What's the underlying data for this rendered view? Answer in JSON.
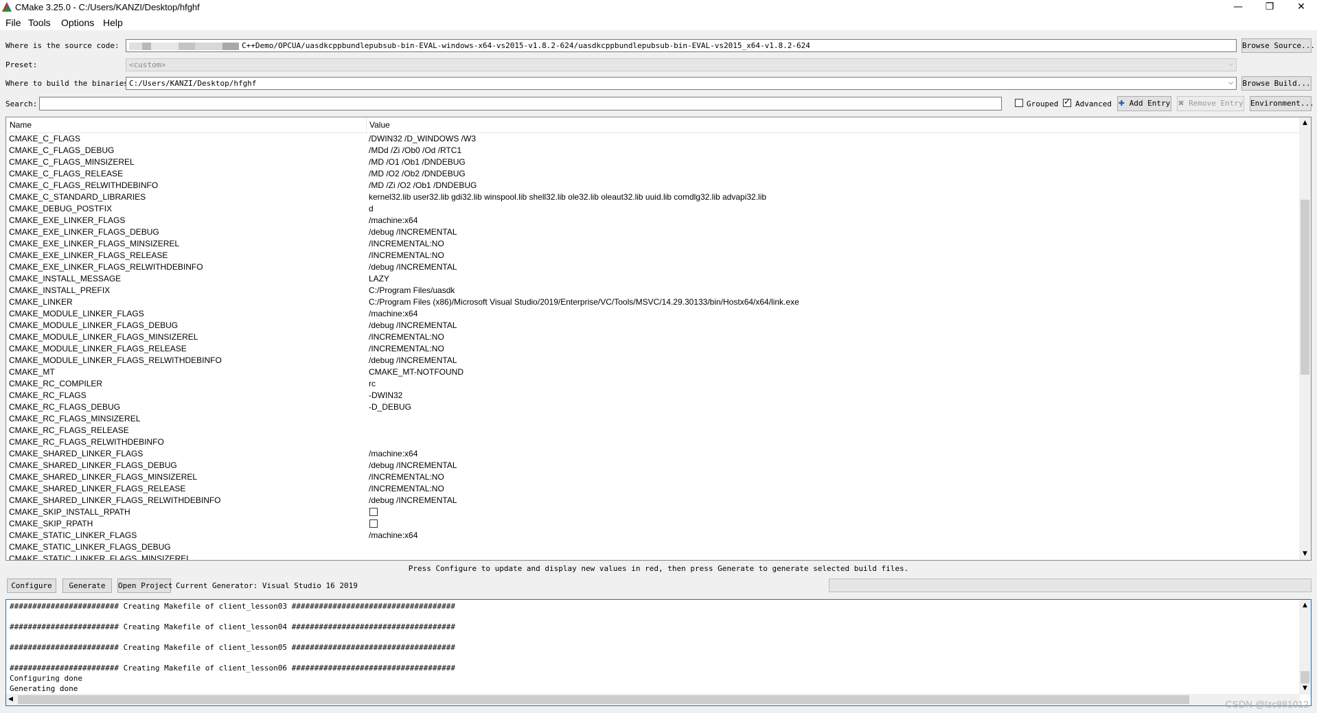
{
  "window": {
    "title": "CMake 3.25.0 - C:/Users/KANZI/Desktop/hfghf",
    "minimize": "—",
    "restore": "❐",
    "close": "✕"
  },
  "menu": [
    "File",
    "Tools",
    "Options",
    "Help"
  ],
  "source": {
    "label": "Where is the source code:",
    "value": "C++Demo/OPCUA/uasdkcppbundlepubsub-bin-EVAL-windows-x64-vs2015-v1.8.2-624/uasdkcppbundlepubsub-bin-EVAL-vs2015_x64-v1.8.2-624",
    "browse": "Browse Source..."
  },
  "preset": {
    "label": "Preset:",
    "value": "<custom>"
  },
  "build": {
    "label": "Where to build the binaries:",
    "value": "C:/Users/KANZI/Desktop/hfghf",
    "browse": "Browse Build..."
  },
  "search": {
    "label": "Search:",
    "value": "",
    "grouped": "Grouped",
    "grouped_checked": false,
    "advanced": "Advanced",
    "advanced_checked": true,
    "add_entry": "Add Entry",
    "remove_entry": "Remove Entry",
    "environment": "Environment..."
  },
  "table": {
    "col_name": "Name",
    "col_value": "Value",
    "rows": [
      {
        "name": "CMAKE_C_FLAGS",
        "value": "/DWIN32 /D_WINDOWS /W3"
      },
      {
        "name": "CMAKE_C_FLAGS_DEBUG",
        "value": "/MDd /Zi /Ob0 /Od /RTC1"
      },
      {
        "name": "CMAKE_C_FLAGS_MINSIZEREL",
        "value": "/MD /O1 /Ob1 /DNDEBUG"
      },
      {
        "name": "CMAKE_C_FLAGS_RELEASE",
        "value": "/MD /O2 /Ob2 /DNDEBUG"
      },
      {
        "name": "CMAKE_C_FLAGS_RELWITHDEBINFO",
        "value": "/MD /Zi /O2 /Ob1 /DNDEBUG"
      },
      {
        "name": "CMAKE_C_STANDARD_LIBRARIES",
        "value": "kernel32.lib user32.lib gdi32.lib winspool.lib shell32.lib ole32.lib oleaut32.lib uuid.lib comdlg32.lib advapi32.lib"
      },
      {
        "name": "CMAKE_DEBUG_POSTFIX",
        "value": "d"
      },
      {
        "name": "CMAKE_EXE_LINKER_FLAGS",
        "value": "/machine:x64"
      },
      {
        "name": "CMAKE_EXE_LINKER_FLAGS_DEBUG",
        "value": "/debug /INCREMENTAL"
      },
      {
        "name": "CMAKE_EXE_LINKER_FLAGS_MINSIZEREL",
        "value": "/INCREMENTAL:NO"
      },
      {
        "name": "CMAKE_EXE_LINKER_FLAGS_RELEASE",
        "value": "/INCREMENTAL:NO"
      },
      {
        "name": "CMAKE_EXE_LINKER_FLAGS_RELWITHDEBINFO",
        "value": "/debug /INCREMENTAL"
      },
      {
        "name": "CMAKE_INSTALL_MESSAGE",
        "value": "LAZY"
      },
      {
        "name": "CMAKE_INSTALL_PREFIX",
        "value": "C:/Program Files/uasdk"
      },
      {
        "name": "CMAKE_LINKER",
        "value": "C:/Program Files (x86)/Microsoft Visual Studio/2019/Enterprise/VC/Tools/MSVC/14.29.30133/bin/Hostx64/x64/link.exe"
      },
      {
        "name": "CMAKE_MODULE_LINKER_FLAGS",
        "value": "/machine:x64"
      },
      {
        "name": "CMAKE_MODULE_LINKER_FLAGS_DEBUG",
        "value": "/debug /INCREMENTAL"
      },
      {
        "name": "CMAKE_MODULE_LINKER_FLAGS_MINSIZEREL",
        "value": "/INCREMENTAL:NO"
      },
      {
        "name": "CMAKE_MODULE_LINKER_FLAGS_RELEASE",
        "value": "/INCREMENTAL:NO"
      },
      {
        "name": "CMAKE_MODULE_LINKER_FLAGS_RELWITHDEBINFO",
        "value": "/debug /INCREMENTAL"
      },
      {
        "name": "CMAKE_MT",
        "value": "CMAKE_MT-NOTFOUND"
      },
      {
        "name": "CMAKE_RC_COMPILER",
        "value": "rc"
      },
      {
        "name": "CMAKE_RC_FLAGS",
        "value": "-DWIN32"
      },
      {
        "name": "CMAKE_RC_FLAGS_DEBUG",
        "value": "-D_DEBUG"
      },
      {
        "name": "CMAKE_RC_FLAGS_MINSIZEREL",
        "value": ""
      },
      {
        "name": "CMAKE_RC_FLAGS_RELEASE",
        "value": ""
      },
      {
        "name": "CMAKE_RC_FLAGS_RELWITHDEBINFO",
        "value": ""
      },
      {
        "name": "CMAKE_SHARED_LINKER_FLAGS",
        "value": "/machine:x64"
      },
      {
        "name": "CMAKE_SHARED_LINKER_FLAGS_DEBUG",
        "value": "/debug /INCREMENTAL"
      },
      {
        "name": "CMAKE_SHARED_LINKER_FLAGS_MINSIZEREL",
        "value": "/INCREMENTAL:NO"
      },
      {
        "name": "CMAKE_SHARED_LINKER_FLAGS_RELEASE",
        "value": "/INCREMENTAL:NO"
      },
      {
        "name": "CMAKE_SHARED_LINKER_FLAGS_RELWITHDEBINFO",
        "value": "/debug /INCREMENTAL"
      },
      {
        "name": "CMAKE_SKIP_INSTALL_RPATH",
        "checkbox": true
      },
      {
        "name": "CMAKE_SKIP_RPATH",
        "checkbox": true
      },
      {
        "name": "CMAKE_STATIC_LINKER_FLAGS",
        "value": "/machine:x64"
      },
      {
        "name": "CMAKE_STATIC_LINKER_FLAGS_DEBUG",
        "value": ""
      },
      {
        "name": "CMAKE_STATIC_LINKER_FLAGS_MINSIZEREL",
        "value": ""
      }
    ]
  },
  "hint": "Press Configure to update and display new values in red, then press Generate to generate selected build files.",
  "actions": {
    "configure": "Configure",
    "generate": "Generate",
    "open_project": "Open Project",
    "generator": "Current Generator: Visual Studio 16 2019"
  },
  "output": {
    "lines": [
      "######################## Creating Makefile of client_lesson03 ####################################",
      "",
      "######################## Creating Makefile of client_lesson04 ####################################",
      "",
      "######################## Creating Makefile of client_lesson05 ####################################",
      "",
      "######################## Creating Makefile of client_lesson06 ####################################",
      "Configuring done",
      "Generating done"
    ]
  },
  "watermark": "CSDN @lzc881012"
}
